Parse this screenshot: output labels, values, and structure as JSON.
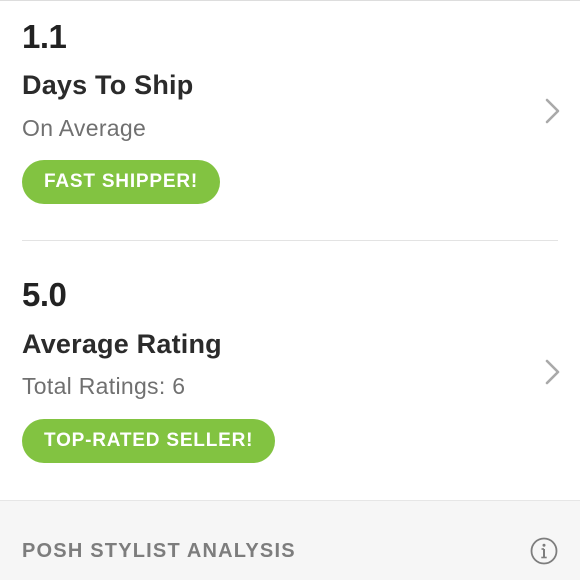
{
  "shipping": {
    "value": "1.1",
    "title": "Days To Ship",
    "subtitle": "On Average",
    "badge": "FAST SHIPPER!"
  },
  "rating": {
    "value": "5.0",
    "title": "Average Rating",
    "subtitle": "Total Ratings: 6",
    "badge": "TOP-RATED SELLER!"
  },
  "analysis": {
    "title": "POSH STYLIST ANALYSIS"
  },
  "icons": {
    "chevron": "chevron-right-icon",
    "info": "info-icon"
  },
  "colors": {
    "badge_green": "#82c341",
    "text_dark": "#222222",
    "text_muted": "#707070",
    "analysis_bg": "#f6f6f6"
  }
}
